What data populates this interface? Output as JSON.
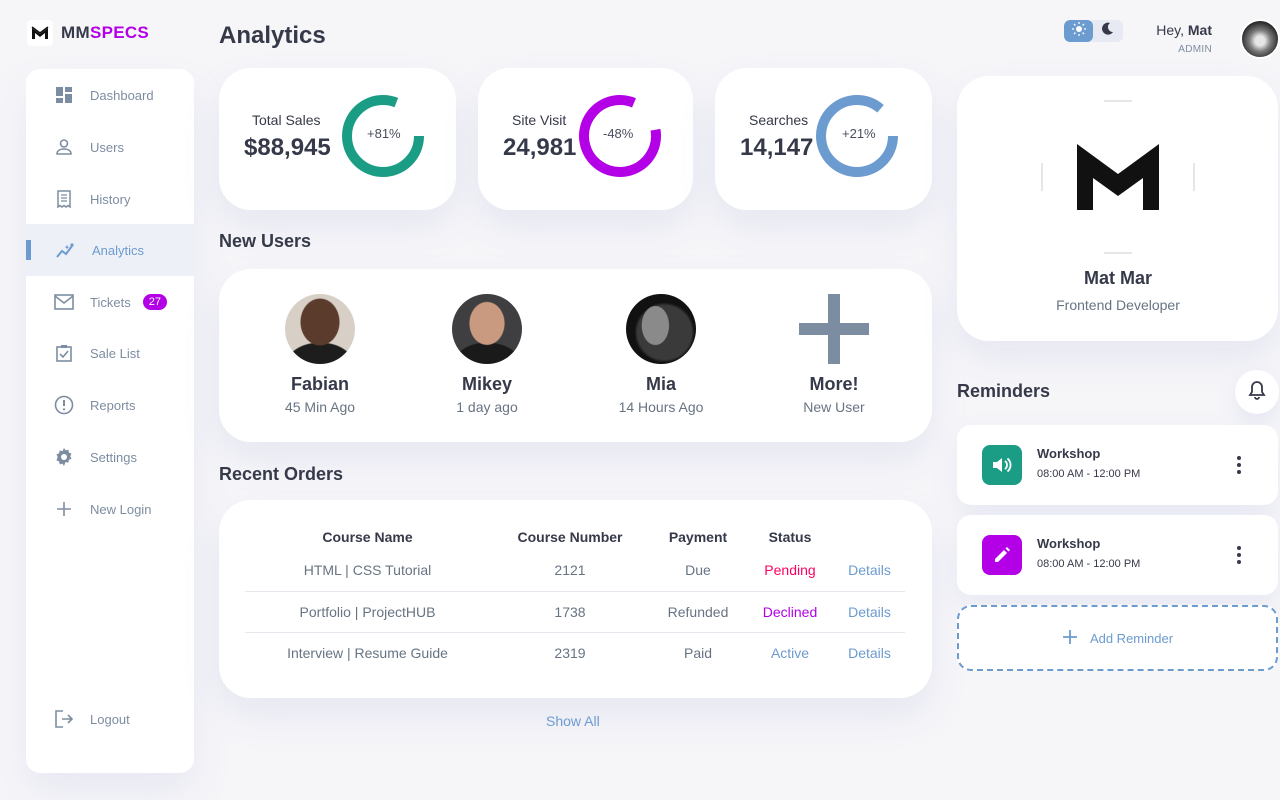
{
  "brand": {
    "part1": "MM",
    "part2": "SPECS"
  },
  "page_title": "Analytics",
  "sidebar": {
    "items": [
      {
        "label": "Dashboard",
        "icon": "dashboard-icon"
      },
      {
        "label": "Users",
        "icon": "user-icon"
      },
      {
        "label": "History",
        "icon": "receipt-icon"
      },
      {
        "label": "Analytics",
        "icon": "insights-icon",
        "active": true
      },
      {
        "label": "Tickets",
        "icon": "mail-icon",
        "badge": "27"
      },
      {
        "label": "Sale List",
        "icon": "clipboard-check-icon"
      },
      {
        "label": "Reports",
        "icon": "alert-circle-icon"
      },
      {
        "label": "Settings",
        "icon": "gear-icon"
      },
      {
        "label": "New Login",
        "icon": "plus-icon"
      }
    ],
    "logout": "Logout"
  },
  "header": {
    "greeting": "Hey, ",
    "user": "Mat",
    "role": "ADMIN"
  },
  "stats": [
    {
      "label": "Total Sales",
      "value": "$88,945",
      "percent": "+81%",
      "color": "#1b9c85"
    },
    {
      "label": "Site Visit",
      "value": "24,981",
      "percent": "-48%",
      "color": "#b300e6"
    },
    {
      "label": "Searches",
      "value": "14,147",
      "percent": "+21%",
      "color": "#6c9bcf"
    }
  ],
  "new_users": {
    "title": "New Users",
    "users": [
      {
        "name": "Fabian",
        "time": "45 Min Ago"
      },
      {
        "name": "Mikey",
        "time": "1 day ago"
      },
      {
        "name": "Mia",
        "time": "14 Hours Ago"
      },
      {
        "name": "More!",
        "time": "New User"
      }
    ]
  },
  "orders": {
    "title": "Recent Orders",
    "columns": [
      "Course Name",
      "Course Number",
      "Payment",
      "Status"
    ],
    "rows": [
      {
        "name": "HTML | CSS Tutorial",
        "number": "2121",
        "payment": "Due",
        "status": "Pending",
        "action": "Details"
      },
      {
        "name": "Portfolio | ProjectHUB",
        "number": "1738",
        "payment": "Refunded",
        "status": "Declined",
        "action": "Details"
      },
      {
        "name": "Interview | Resume Guide",
        "number": "2319",
        "payment": "Paid",
        "status": "Active",
        "action": "Details"
      }
    ],
    "show_all": "Show All"
  },
  "profile": {
    "name": "Mat Mar",
    "role": "Frontend Developer"
  },
  "reminders": {
    "title": "Reminders",
    "items": [
      {
        "title": "Workshop",
        "time": "08:00 AM - 12:00 PM",
        "icon": "volume-icon",
        "color": "#1b9c85"
      },
      {
        "title": "Workshop",
        "time": "08:00 AM - 12:00 PM",
        "icon": "edit-icon",
        "color": "#b300e6"
      }
    ],
    "add_label": "Add Reminder"
  },
  "colors": {
    "primary": "#6c9bcf",
    "success": "#1b9c85",
    "purple": "#b300e6",
    "danger": "#ff0060"
  }
}
